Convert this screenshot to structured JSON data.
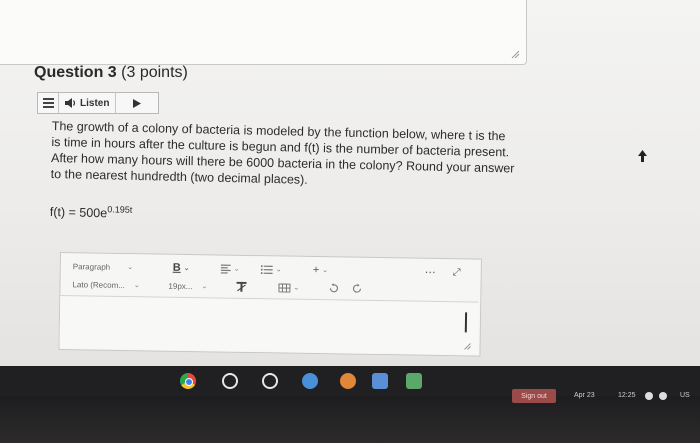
{
  "question": {
    "title": "Question 3",
    "points": "(3 points)",
    "listen_label": "Listen",
    "body_lines": [
      "The growth of a colony of bacteria is modeled by the function below, where t is the",
      "is time in hours after the culture is begun and f(t) is the number of bacteria present.",
      "After how many hours will there be 6000 bacteria in the colony? Round your answer",
      "to the nearest hundredth (two decimal places)."
    ],
    "formula_base": "f(t) = 500e",
    "formula_exponent": "0.195t"
  },
  "editor": {
    "paragraph_label": "Paragraph",
    "bold_label": "B",
    "font_label": "Lato (Recom...",
    "size_label": "19px...",
    "insert_label": "+",
    "more_label": "⋯",
    "expand_label": "⤢"
  },
  "taskbar": {
    "signout_label": "Sign out",
    "date": "Apr 23",
    "time": "12:25",
    "region": "US"
  },
  "colors": {
    "signout_bg": "#9a4a48",
    "taskbar_bg": "#1f1f22"
  }
}
